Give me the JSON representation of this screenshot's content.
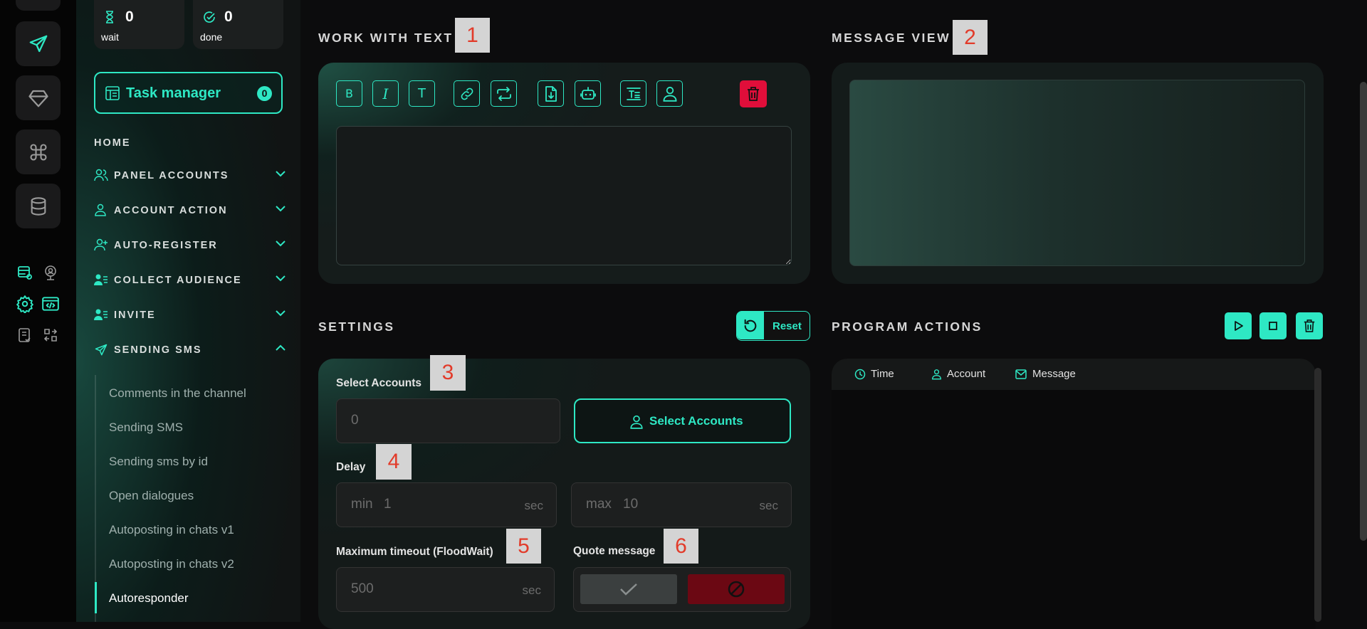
{
  "stats": [
    {
      "value": "0",
      "label": "wait",
      "icon": "hourglass-icon"
    },
    {
      "value": "0",
      "label": "done",
      "icon": "check-circle-icon"
    }
  ],
  "task_manager": {
    "label": "Task manager",
    "count": "0"
  },
  "nav": {
    "home": "HOME",
    "items": [
      {
        "label": "PANEL ACCOUNTS",
        "icon": "users-icon"
      },
      {
        "label": "ACCOUNT ACTION",
        "icon": "user-icon"
      },
      {
        "label": "AUTO-REGISTER",
        "icon": "user-plus-icon"
      },
      {
        "label": "COLLECT AUDIENCE",
        "icon": "user-list-icon"
      },
      {
        "label": "INVITE",
        "icon": "user-list-icon"
      },
      {
        "label": "SENDING SMS",
        "icon": "send-icon"
      }
    ],
    "sub_items": [
      "Comments in the channel",
      "Sending SMS",
      "Sending sms by id",
      "Open dialogues",
      "Autoposting in chats v1",
      "Autoposting in chats v2",
      "Autoresponder"
    ],
    "active_sub": "Autoresponder"
  },
  "work_with_text": {
    "title": "WORK WITH TEXT",
    "marker": "1"
  },
  "message_view": {
    "title": "MESSAGE VIEW",
    "marker": "2"
  },
  "toolbar": {
    "bold": "B",
    "italic": "I",
    "text": "T"
  },
  "settings": {
    "title": "SETTINGS",
    "reset_label": "Reset",
    "select_accounts": {
      "label": "Select Accounts",
      "marker": "3",
      "value": "0",
      "button_label": "Select Accounts"
    },
    "delay": {
      "label": "Delay",
      "marker": "4",
      "min_prefix": "min",
      "min_value": "1",
      "max_prefix": "max",
      "max_value": "10",
      "unit": "sec"
    },
    "timeout": {
      "label": "Maximum timeout (FloodWait)",
      "marker": "5",
      "value": "500",
      "unit": "sec"
    },
    "quote": {
      "label": "Quote message",
      "marker": "6"
    }
  },
  "program_actions": {
    "title": "PROGRAM ACTIONS",
    "columns": [
      "Time",
      "Account",
      "Message"
    ]
  },
  "colors": {
    "accent": "#2ee8c4",
    "danger": "#e00e3a",
    "marker_text": "#e23b2a"
  }
}
